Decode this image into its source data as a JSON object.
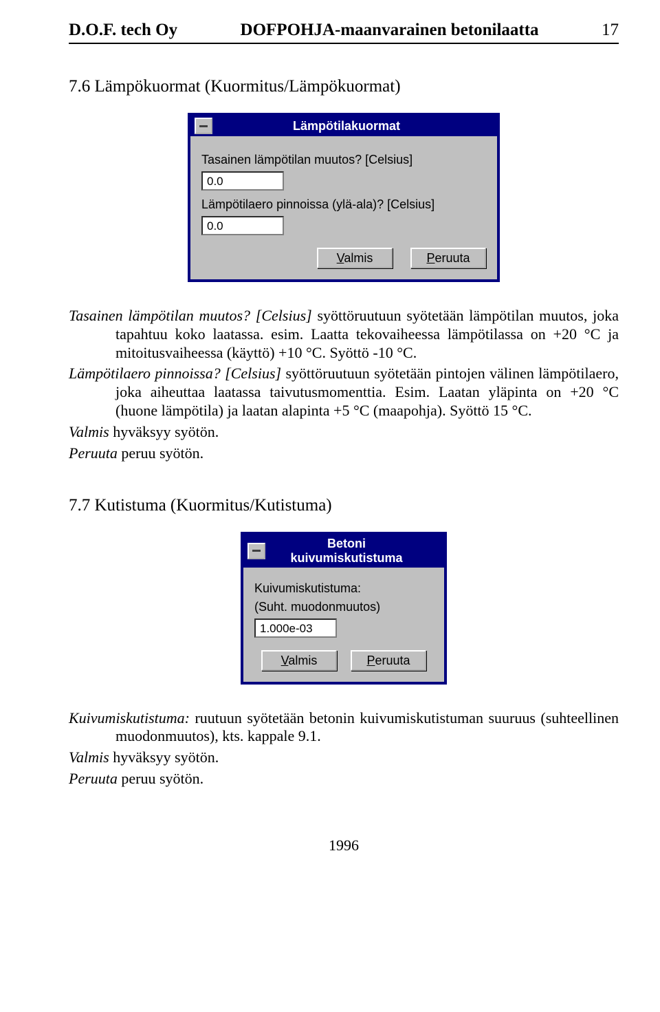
{
  "header": {
    "company": "D.O.F. tech Oy",
    "doc_title": "DOFPOHJA-maanvarainen betonilaatta",
    "page_num": "17"
  },
  "section76": {
    "heading": "7.6 Lämpökuormat (Kuormitus/Lämpökuormat)",
    "dialog": {
      "title": "Lämpötilakuormat",
      "label1": "Tasainen lämpötilan muutos? [Celsius]",
      "value1": "0.0",
      "label2": "Lämpötilaero pinnoissa (ylä-ala)? [Celsius]",
      "value2": "0.0",
      "btn_ok_prefix": "V",
      "btn_ok_rest": "almis",
      "btn_cancel_prefix": "P",
      "btn_cancel_rest": "eruuta"
    },
    "body": {
      "p1_lbl": "Tasainen lämpötilan muutos? [Celsius]",
      "p1_txt": " syöttöruutuun syötetään lämpötilan muutos, joka tapahtuu koko laatassa. esim. Laatta tekovaiheessa lämpötilassa on +20 °C ja mitoitusvaiheessa (käyttö) +10 °C. Syöttö -10 °C.",
      "p2_lbl": "Lämpötilaero pinnoissa? [Celsius]",
      "p2_txt": " syöttöruutuun syötetään pintojen välinen lämpötilaero, joka aiheuttaa laatassa taivutusmomenttia. Esim. Laatan yläpinta on +20 °C (huone lämpötila) ja laatan alapinta +5 °C (maapohja). Syöttö 15 °C.",
      "p3_lbl": "Valmis",
      "p3_txt": "  hyväksyy syötön.",
      "p4_lbl": "Peruuta",
      "p4_txt": " peruu syötön."
    }
  },
  "section77": {
    "heading": "7.7 Kutistuma (Kuormitus/Kutistuma)",
    "dialog": {
      "title": "Betoni kuivumiskutistuma",
      "label1a": "Kuivumiskutistuma:",
      "label1b": "(Suht. muodonmuutos)",
      "value1": "1.000e-03",
      "btn_ok_prefix": "V",
      "btn_ok_rest": "almis",
      "btn_cancel_prefix": "P",
      "btn_cancel_rest": "eruuta"
    },
    "body": {
      "p1_lbl": "Kuivumiskutistuma:",
      "p1_txt": " ruutuun syötetään betonin kuivumiskutistuman suuruus (suhteellinen muodonmuutos), kts. kappale 9.1.",
      "p2_lbl": "Valmis",
      "p2_txt": "  hyväksyy syötön.",
      "p3_lbl": "Peruuta",
      "p3_txt": " peruu syötön."
    }
  },
  "footer": "1996"
}
